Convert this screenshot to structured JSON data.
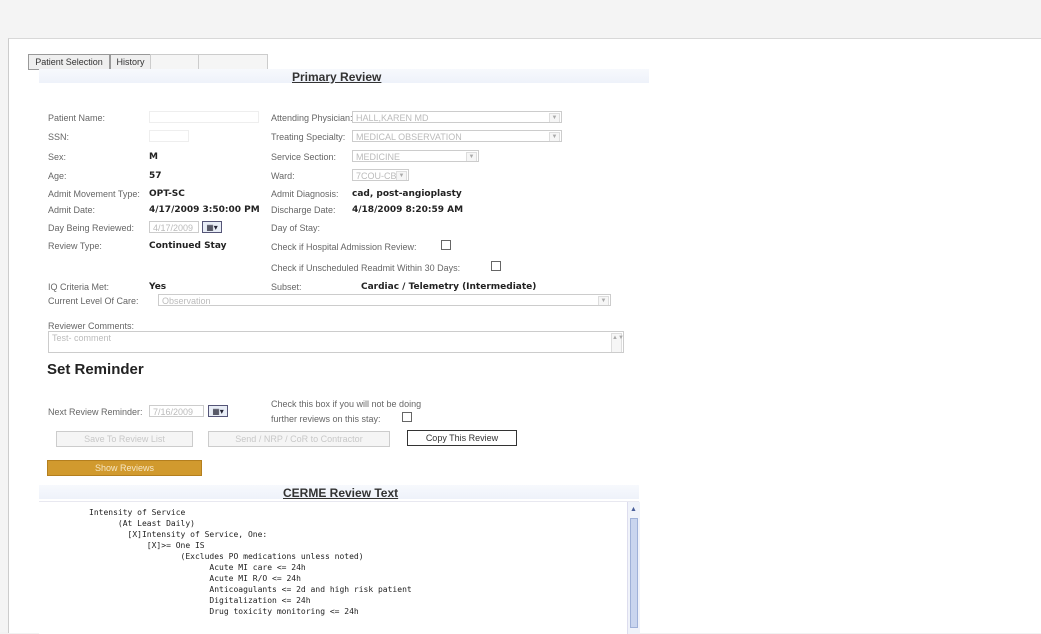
{
  "toolbar": {
    "patient_selection": "Patient Selection",
    "history": "History",
    "btn3": "",
    "btn4": ""
  },
  "primary_review": {
    "title": "Primary Review",
    "labels": {
      "patient_name": "Patient Name:",
      "ssn": "SSN:",
      "sex": "Sex:",
      "age": "Age:",
      "admit_movement_type": "Admit Movement Type:",
      "admit_date": "Admit Date:",
      "day_being_reviewed": "Day Being Reviewed:",
      "review_type": "Review Type:",
      "iq_criteria_met": "IQ Criteria Met:",
      "current_level_of_care": "Current Level Of Care:",
      "reviewer_comments": "Reviewer Comments:",
      "attending_physician": "Attending Physician:",
      "treating_specialty": "Treating Specialty:",
      "service_section": "Service Section:",
      "ward": "Ward:",
      "admit_diagnosis": "Admit Diagnosis:",
      "discharge_date": "Discharge Date:",
      "day_of_stay": "Day of Stay:",
      "hospital_admission_review": "Check if Hospital Admission Review:",
      "unscheduled_readmit": "Check if Unscheduled Readmit Within 30 Days:",
      "subset": "Subset:"
    },
    "values": {
      "patient_name": "",
      "ssn": "",
      "sex": "M",
      "age": "57",
      "admit_movement_type": "OPT-SC",
      "admit_date": "4/17/2009 3:50:00 PM",
      "day_being_reviewed": "4/17/2009",
      "review_type": "Continued Stay",
      "iq_criteria_met": "Yes",
      "current_level_of_care": "Observation",
      "reviewer_comments": "Test- comment",
      "attending_physician": "HALL,KAREN MD",
      "treating_specialty": "MEDICAL OBSERVATION",
      "service_section": "MEDICINE",
      "ward": "7COU-CBR",
      "admit_diagnosis": "cad, post-angioplasty",
      "discharge_date": "4/18/2009 8:20:59 AM",
      "day_of_stay": "",
      "subset": "Cardiac / Telemetry (Intermediate)"
    }
  },
  "reminder": {
    "heading": "Set Reminder",
    "next_review_label": "Next Review Reminder:",
    "next_review_value": "7/16/2009",
    "no_further_line1": "Check this box if you will not be doing",
    "no_further_line2": "further reviews on this stay:",
    "btn_save": "Save To Review List",
    "btn_send": "Send / NRP / CoR to Contractor",
    "btn_copy": "Copy This Review",
    "btn_show": "Show Reviews"
  },
  "cerme": {
    "title": "CERME Review Text",
    "lines": [
      "Intensity of Service",
      "      (At Least Daily)",
      "        [X]Intensity of Service, One:",
      "            [X]>= One IS",
      "                   (Excludes PO medications unless noted)",
      "                         Acute MI care <= 24h",
      "                         Acute MI R/O <= 24h",
      "                         Anticoagulants <= 2d and high risk patient",
      "                         Digitalization <= 24h",
      "                         Drug toxicity monitoring <= 24h"
    ]
  },
  "colors": {
    "accent_orange": "#d19a2e",
    "link_blue": "#333333"
  }
}
